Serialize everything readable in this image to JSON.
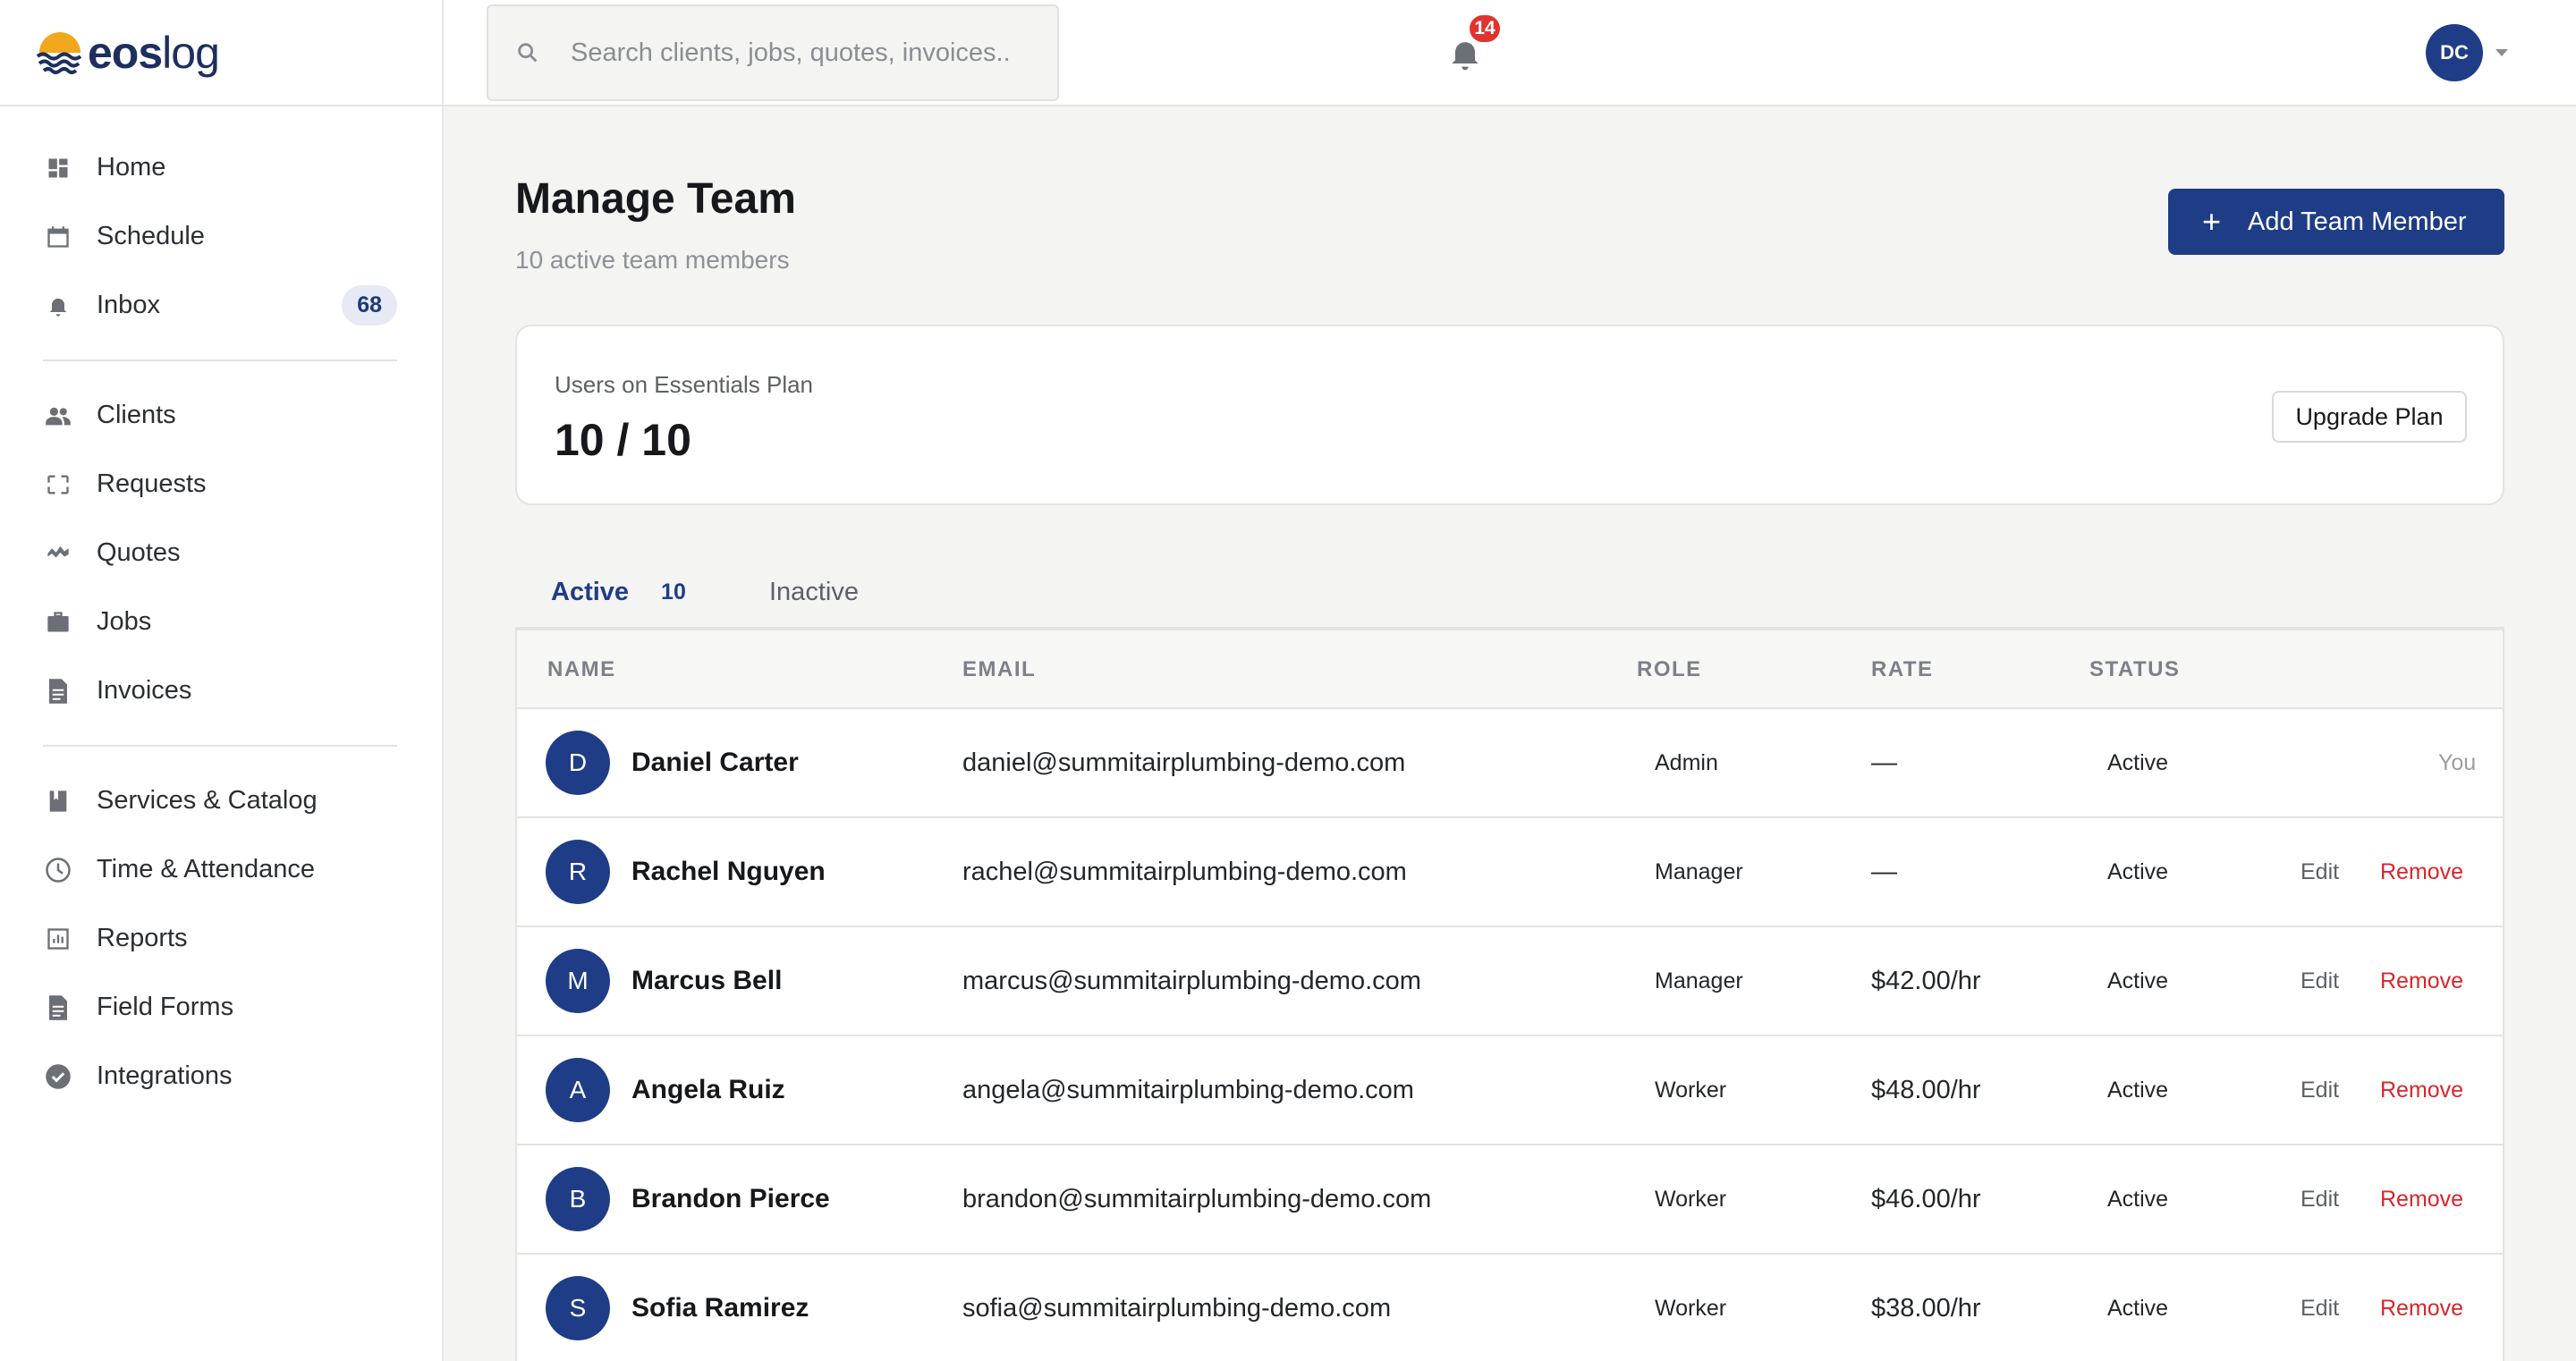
{
  "brand": {
    "name_bold": "eos",
    "name_light": "log"
  },
  "sidebar": {
    "groups": [
      [
        {
          "label": "Home",
          "icon": "dashboard-icon"
        },
        {
          "label": "Schedule",
          "icon": "calendar-icon"
        },
        {
          "label": "Inbox",
          "icon": "bell-icon",
          "badge": "68"
        }
      ],
      [
        {
          "label": "Clients",
          "icon": "people-icon"
        },
        {
          "label": "Requests",
          "icon": "request-icon"
        },
        {
          "label": "Quotes",
          "icon": "quotes-icon"
        },
        {
          "label": "Jobs",
          "icon": "briefcase-icon"
        },
        {
          "label": "Invoices",
          "icon": "document-icon"
        }
      ],
      [
        {
          "label": "Services & Catalog",
          "icon": "book-icon"
        },
        {
          "label": "Time & Attendance",
          "icon": "clock-icon"
        },
        {
          "label": "Reports",
          "icon": "chart-icon"
        },
        {
          "label": "Field Forms",
          "icon": "form-icon"
        },
        {
          "label": "Integrations",
          "icon": "check-circle-icon"
        }
      ]
    ]
  },
  "topbar": {
    "search_placeholder": "Search clients, jobs, quotes, invoices..",
    "notification_count": "14",
    "user_initials": "DC"
  },
  "page": {
    "title": "Manage Team",
    "subtitle": "10 active team members",
    "add_button": "Add Team Member"
  },
  "plan": {
    "label": "Users on Essentials Plan",
    "value": "10 / 10",
    "upgrade_button": "Upgrade Plan"
  },
  "tabs": {
    "active_label": "Active",
    "active_count": "10",
    "inactive_label": "Inactive"
  },
  "table": {
    "headers": {
      "name": "NAME",
      "email": "EMAIL",
      "role": "ROLE",
      "rate": "RATE",
      "status": "STATUS"
    },
    "edit_label": "Edit",
    "remove_label": "Remove",
    "rows": [
      {
        "initial": "D",
        "name": "Daniel Carter",
        "email": "daniel@summitairplumbing-demo.com",
        "role": "Admin",
        "rate": "—",
        "status": "Active",
        "note": "You"
      },
      {
        "initial": "R",
        "name": "Rachel Nguyen",
        "email": "rachel@summitairplumbing-demo.com",
        "role": "Manager",
        "rate": "—",
        "status": "Active"
      },
      {
        "initial": "M",
        "name": "Marcus Bell",
        "email": "marcus@summitairplumbing-demo.com",
        "role": "Manager",
        "rate": "$42.00/hr",
        "status": "Active"
      },
      {
        "initial": "A",
        "name": "Angela Ruiz",
        "email": "angela@summitairplumbing-demo.com",
        "role": "Worker",
        "rate": "$48.00/hr",
        "status": "Active"
      },
      {
        "initial": "B",
        "name": "Brandon Pierce",
        "email": "brandon@summitairplumbing-demo.com",
        "role": "Worker",
        "rate": "$46.00/hr",
        "status": "Active"
      },
      {
        "initial": "S",
        "name": "Sofia Ramirez",
        "email": "sofia@summitairplumbing-demo.com",
        "role": "Worker",
        "rate": "$38.00/hr",
        "status": "Active"
      }
    ]
  },
  "colors": {
    "accent": "#1f3d86",
    "danger": "#d9262b",
    "badge": "#e0332f"
  }
}
